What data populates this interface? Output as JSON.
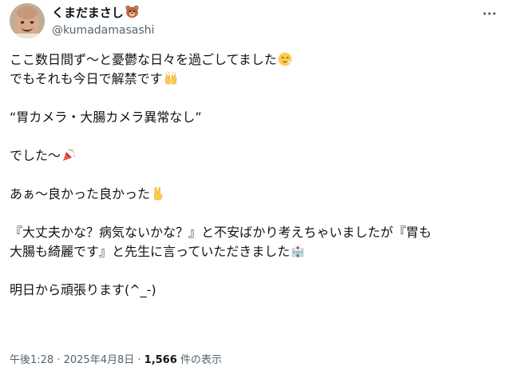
{
  "user": {
    "display_name": "くまだまさし",
    "handle": "@kumadamasashi",
    "badge_icon": "bear-face-icon"
  },
  "tweet": {
    "lines": [
      "ここ数日間ず〜と憂鬱な日々を過ごしてました",
      "でもそれも今日で解禁です",
      "",
      "“胃カメラ・大腸カメラ異常なし”",
      "",
      "でした〜",
      "",
      "あぁ〜良かった良かった",
      "",
      "『大丈夫かな？病気ないかな？』と不安ばかり考えちゃいましたが『胃も",
      "大腸も綺麗です』と先生に言っていただきました",
      "",
      "明日から頑張ります(^_-)"
    ],
    "emojis": {
      "line_0": "relieved-face-icon",
      "line_1": "raising-hands-icon",
      "line_5": "party-popper-icon",
      "line_7": "victory-hand-icon",
      "line_10": "hospital-icon"
    }
  },
  "meta": {
    "time": "午後1:28",
    "separator1": " · ",
    "date": "2025年4月8日",
    "separator2": " · ",
    "views_count": "1,566",
    "views_label": " 件の表示"
  },
  "colors": {
    "text": "#0f1419",
    "secondary": "#536471"
  }
}
